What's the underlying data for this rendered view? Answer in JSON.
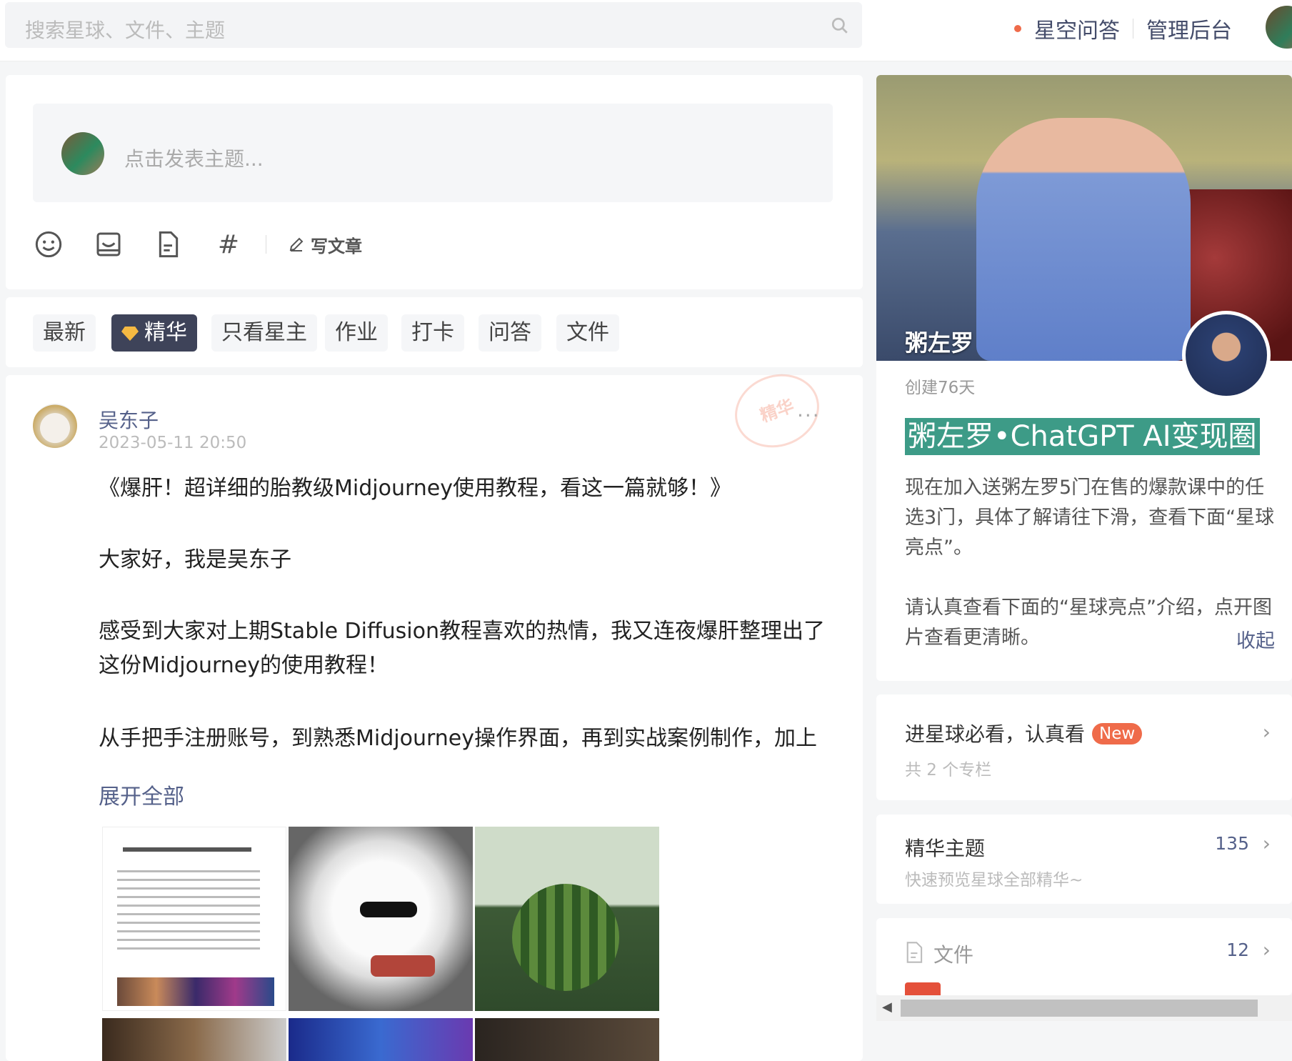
{
  "header": {
    "search_placeholder": "搜索星球、文件、主题",
    "link_qa": "星空问答",
    "link_admin": "管理后台"
  },
  "composer": {
    "placeholder": "点击发表主题...",
    "write_article": "写文章"
  },
  "filters": {
    "tabs": [
      "最新",
      "精华",
      "只看星主",
      "作业",
      "打卡",
      "问答",
      "文件"
    ],
    "active": "精华"
  },
  "post": {
    "author": "吴东子",
    "time": "2023-05-11 20:50",
    "stamp": "精华",
    "more": "···",
    "lines": [
      "《爆肝！超详细的胎教级Midjourney使用教程，看这一篇就够！》",
      "大家好，我是吴东子",
      "感受到大家对上期Stable Diffusion教程喜欢的热情，我又连夜爆肝整理出了这份Midjourney的使用教程！",
      "从手把手注册账号，到熟悉Midjourney操作界面，再到实战案例制作，加上"
    ],
    "expand": "展开全部"
  },
  "group": {
    "cover_name": "粥左罗",
    "created": "创建76天",
    "title": "粥左罗•ChatGPT AI变现圈",
    "desc1": "现在加入送粥左罗5门在售的爆款课中的任选3门，具体了解请往下滑，查看下面“星球亮点”。",
    "desc2": "请认真查看下面的“星球亮点”介绍，点开图片查看更清晰。",
    "collapse": "收起"
  },
  "side_blocks": {
    "columns_title": "进星球必看，认真看",
    "columns_badge": "New",
    "columns_sub": "共 2 个专栏",
    "digest_title": "精华主题",
    "digest_count": "135",
    "digest_sub": "快速预览星球全部精华~",
    "files_title": "文件",
    "files_count": "12"
  }
}
